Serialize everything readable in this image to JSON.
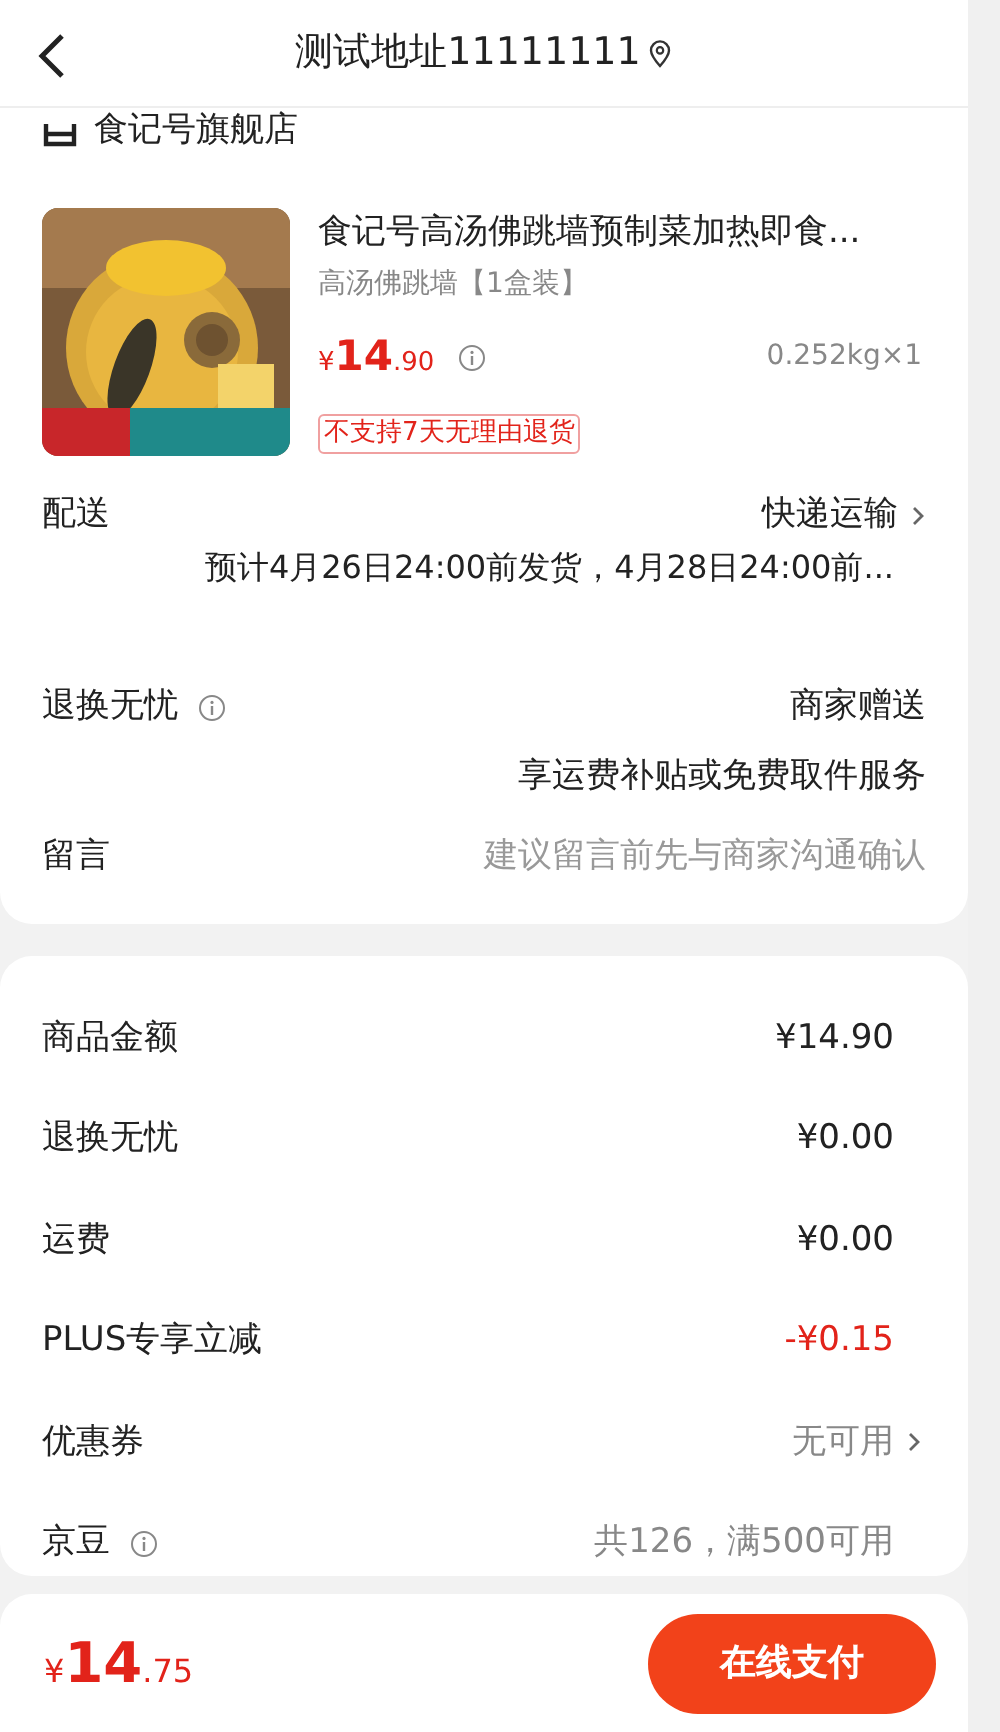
{
  "header": {
    "title": "测试地址11111111"
  },
  "store": {
    "name": "食记号旗舰店"
  },
  "product": {
    "name": "食记号高汤佛跳墙预制菜加热即食...",
    "spec": "高汤佛跳墙【1盒装】",
    "price_symbol": "¥",
    "price_int": "14",
    "price_dec": ".90",
    "weight": "0.252kg×1",
    "tag": "不支持7天无理由退货"
  },
  "delivery": {
    "label": "配送",
    "value": "快递运输",
    "note": "预计4月26日24:00前发货，4月28日24:00前..."
  },
  "return_service": {
    "label": "退换无忧",
    "value": "商家赠送",
    "note": "享运费补贴或免费取件服务"
  },
  "message": {
    "label": "留言",
    "placeholder": "建议留言前先与商家沟通确认"
  },
  "summary": [
    {
      "label": "商品金额",
      "value": "¥14.90",
      "kind": "plain",
      "info": false,
      "chevron": false
    },
    {
      "label": "退换无忧",
      "value": "¥0.00",
      "kind": "plain",
      "info": false,
      "chevron": false
    },
    {
      "label": "运费",
      "value": "¥0.00",
      "kind": "plain",
      "info": false,
      "chevron": false
    },
    {
      "label": "PLUS专享立减",
      "value": "-¥0.15",
      "kind": "discount",
      "info": false,
      "chevron": false
    },
    {
      "label": "优惠券",
      "value": "无可用",
      "kind": "muted",
      "info": false,
      "chevron": true
    },
    {
      "label": "京豆",
      "value": "共126，满500可用",
      "kind": "muted",
      "info": true,
      "chevron": false
    }
  ],
  "footer": {
    "symbol": "¥",
    "total_int": "14",
    "total_dec": ".75",
    "button": "在线支付"
  }
}
